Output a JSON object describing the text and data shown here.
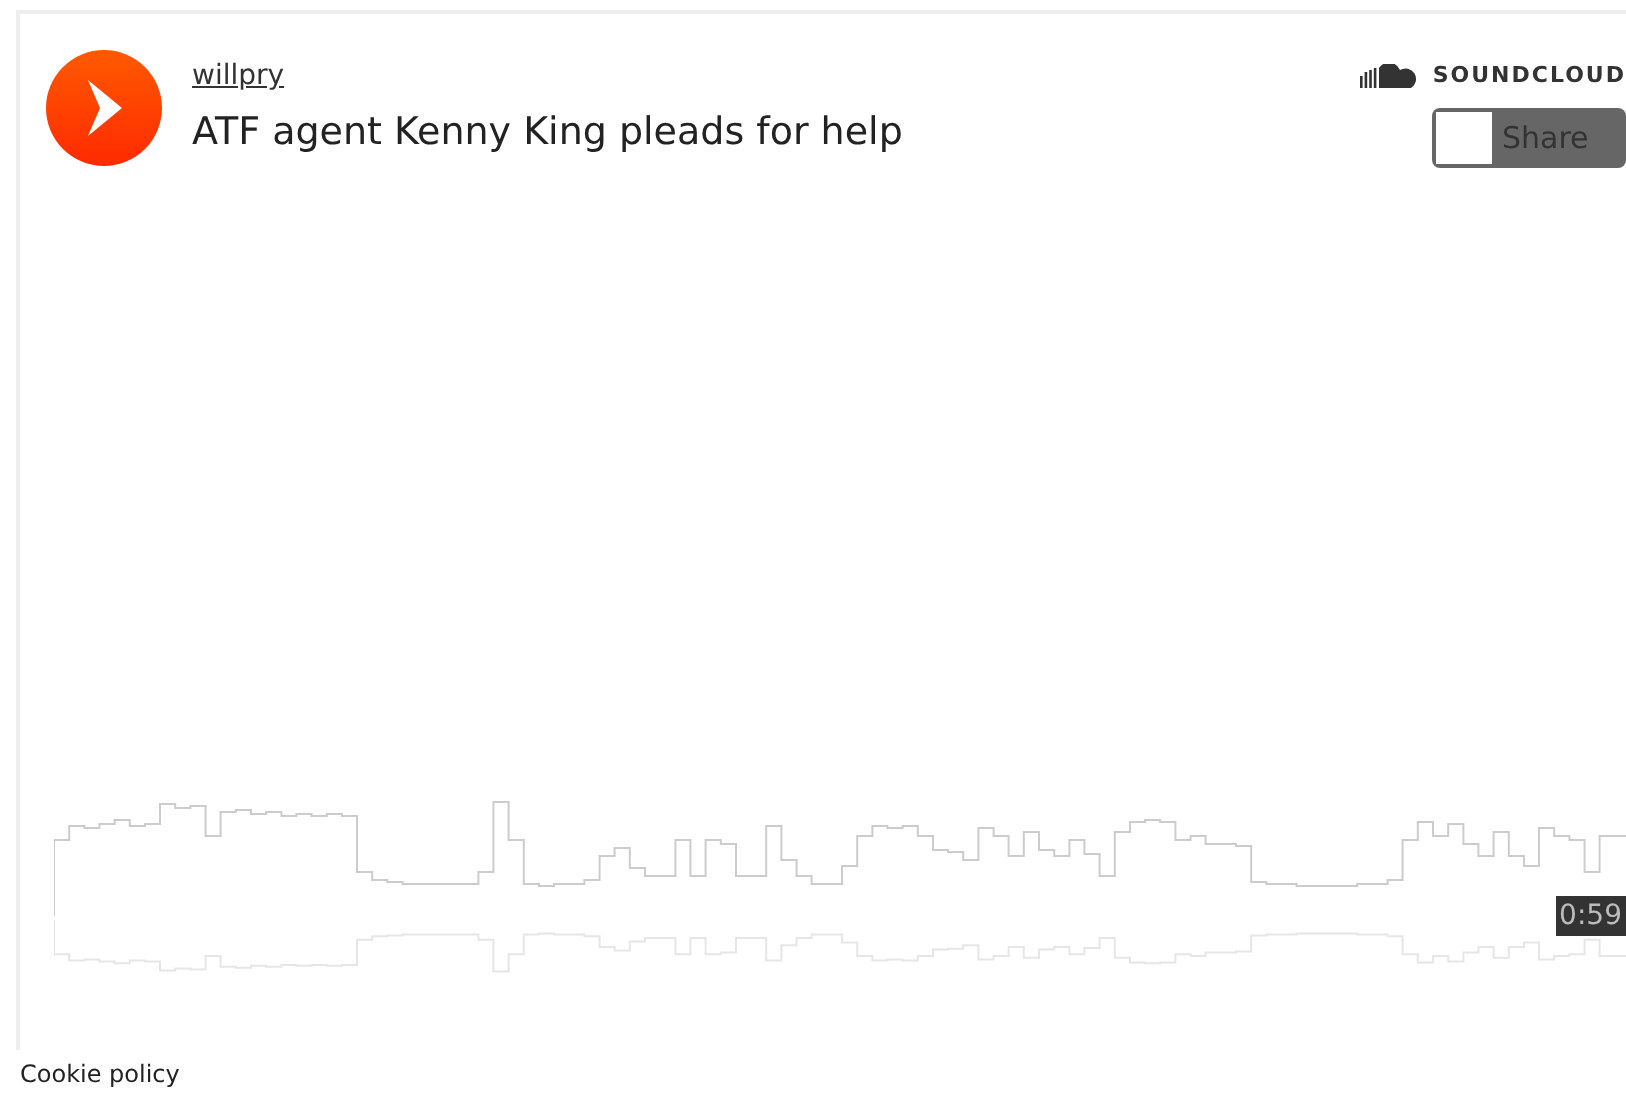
{
  "player": {
    "user": "willpry",
    "title": "ATF agent Kenny King pleads for help",
    "brand": "SOUNDCLOUD",
    "share_button": "Share",
    "duration": "0:59"
  },
  "footer": {
    "link": "Cookie policy"
  }
}
